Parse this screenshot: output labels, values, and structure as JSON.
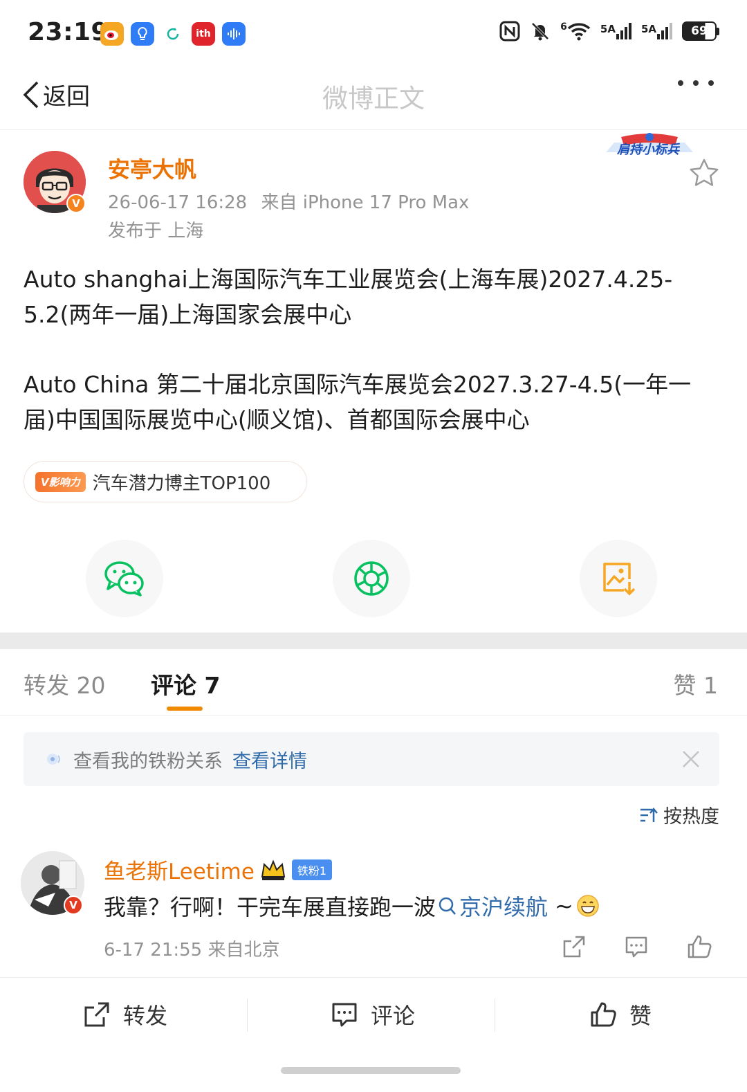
{
  "status_bar": {
    "time": "23:19",
    "battery": "69",
    "network_labels": [
      "6",
      "5A",
      "5A"
    ]
  },
  "nav": {
    "back_label": "返回",
    "title": "微博正文"
  },
  "post": {
    "username": "安亭大帆",
    "timestamp": "26-06-17 16:28",
    "source": "来自 iPhone 17 Pro Max",
    "location": "发布于 上海",
    "fan_badge": "肩持小标兵",
    "paragraphs": [
      "Auto shanghai上海国际汽车工业展览会(上海车展)2027.4.25-5.2(两年一届)上海国家会展中心",
      "Auto China 第二十届北京国际汽车展览会2027.3.27-4.5(一年一届)中国国际展览中心(顺义馆)、首都国际会展中心"
    ],
    "tag_badge": "V影响力",
    "tag_text": "汽车潜力博主TOP100"
  },
  "share": {
    "icons": [
      "wechat-icon",
      "moments-icon",
      "save-image-icon"
    ]
  },
  "tabs": {
    "repost": "转发 20",
    "comments": "评论 7",
    "likes": "赞 1"
  },
  "notice": {
    "text": "查看我的铁粉关系",
    "link": "查看详情"
  },
  "sort_label": "按热度",
  "comment": {
    "username": "鱼老斯Leetime",
    "fan_level": "铁粉1",
    "text_before": "我靠？行啊！干完车展直接跑一波",
    "topic": "京沪续航",
    "text_after": "~",
    "meta": "6-17 21:55 来自北京"
  },
  "bottom_bar": {
    "repost": "转发",
    "comment": "评论",
    "like": "赞"
  },
  "colors": {
    "accent_orange": "#eb7305",
    "link_blue": "#2f6bab",
    "wechat_green": "#07c160",
    "save_orange": "#f5a623"
  }
}
